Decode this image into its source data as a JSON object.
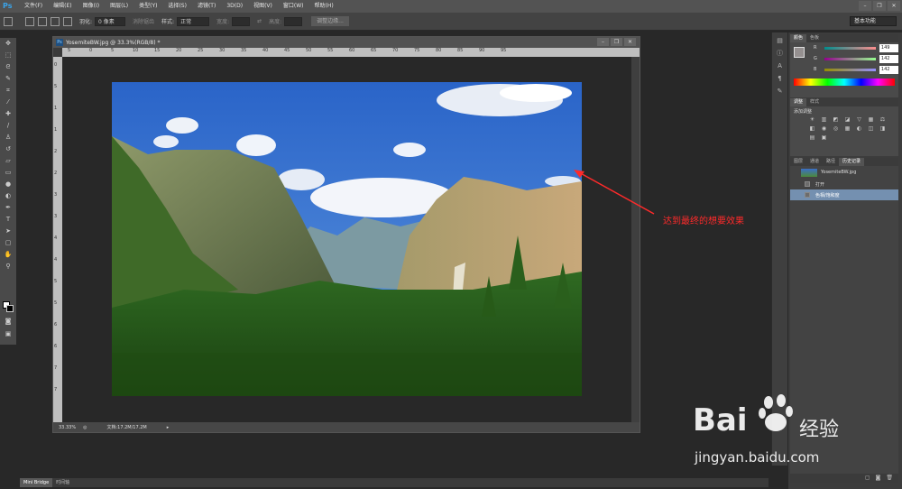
{
  "menubar": {
    "logo": "Ps",
    "items": [
      "文件(F)",
      "编辑(E)",
      "图像(I)",
      "图层(L)",
      "类型(Y)",
      "选择(S)",
      "滤镜(T)",
      "3D(D)",
      "视图(V)",
      "窗口(W)",
      "帮助(H)"
    ],
    "window_controls": [
      "–",
      "❐",
      "✕"
    ]
  },
  "optbar": {
    "feather_label": "羽化:",
    "feather_value": "0 像素",
    "antialias_label": "消除锯齿",
    "style_label": "样式:",
    "style_value": "正常",
    "width_label": "宽度:",
    "height_label": "高度:",
    "refine_button": "调整边缘...",
    "workspace": "基本功能"
  },
  "document": {
    "title": "YosemiteBW.jpg @ 33.3%(RGB/8) *",
    "ps_icon": "Ps",
    "zoom": "33.33%",
    "doc_size": "文档:17.2M/17.2M",
    "ruler_h": [
      "5",
      "0",
      "5",
      "10",
      "15",
      "20",
      "25",
      "30",
      "35",
      "40",
      "45",
      "50",
      "55",
      "60",
      "65",
      "70",
      "75",
      "80",
      "85",
      "90",
      "95"
    ],
    "ruler_v": [
      "0",
      "5",
      "1",
      "1",
      "2",
      "2",
      "3",
      "3",
      "4",
      "4",
      "5",
      "5",
      "6",
      "6",
      "7",
      "7"
    ]
  },
  "annotation": {
    "text": "达到最终的想要效果",
    "color": "#ff2a2a"
  },
  "panels": {
    "color_tabs": [
      "颜色",
      "色板"
    ],
    "color": {
      "R": {
        "label": "R",
        "value": "149"
      },
      "G": {
        "label": "G",
        "value": "142"
      },
      "B": {
        "label": "B",
        "value": "142"
      }
    },
    "adjust_tabs": [
      "调整",
      "样式"
    ],
    "adjust_title": "添加调整",
    "history_tabs": [
      "图层",
      "通道",
      "路径",
      "历史记录"
    ],
    "snapshot": "YosemiteBW.jpg",
    "history_items": [
      "打开",
      "色相/饱和度"
    ]
  },
  "bottombar": {
    "tabs": [
      "Mini Bridge",
      "时间轴"
    ]
  },
  "watermark": {
    "brand": "Bai",
    "brand_cn": "经验",
    "url": "jingyan.baidu.com"
  }
}
